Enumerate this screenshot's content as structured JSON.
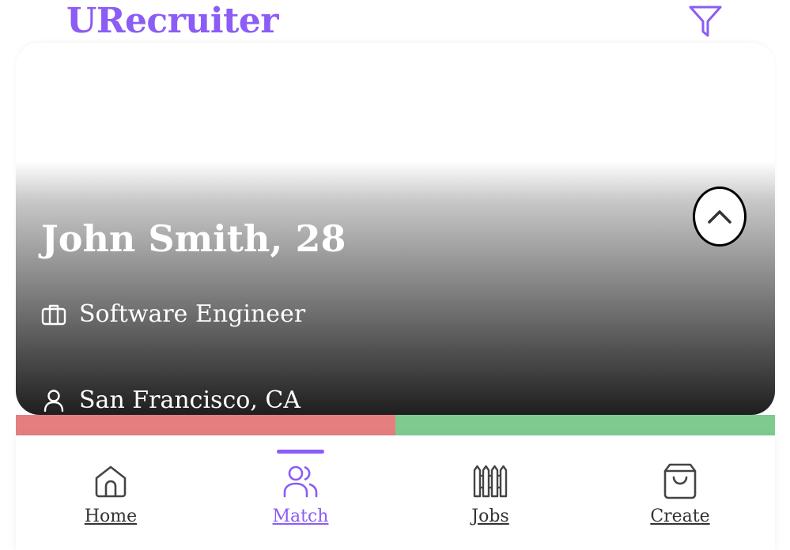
{
  "app": {
    "title": "URecruiter"
  },
  "header": {
    "filter_icon": "filter-icon"
  },
  "candidate": {
    "name_age": "John Smith, 28",
    "job_title": "Software Engineer",
    "location": "San Francisco, CA",
    "job_icon": "briefcase-icon",
    "location_icon": "user-icon",
    "expand_icon": "chevron-up-icon"
  },
  "swipe": {
    "reject_color": "#e57f7f",
    "accept_color": "#7fcb8f"
  },
  "nav": {
    "active": "Match",
    "items": [
      {
        "label": "Home",
        "icon": "home-icon",
        "active": false
      },
      {
        "label": "Match",
        "icon": "users-icon",
        "active": true
      },
      {
        "label": "Jobs",
        "icon": "fence-icon",
        "active": false
      },
      {
        "label": "Create",
        "icon": "shopping-bag-icon",
        "active": false
      }
    ]
  },
  "colors": {
    "accent": "#8b5cf6",
    "text_inactive": "#333333",
    "card_text": "#ffffff"
  }
}
